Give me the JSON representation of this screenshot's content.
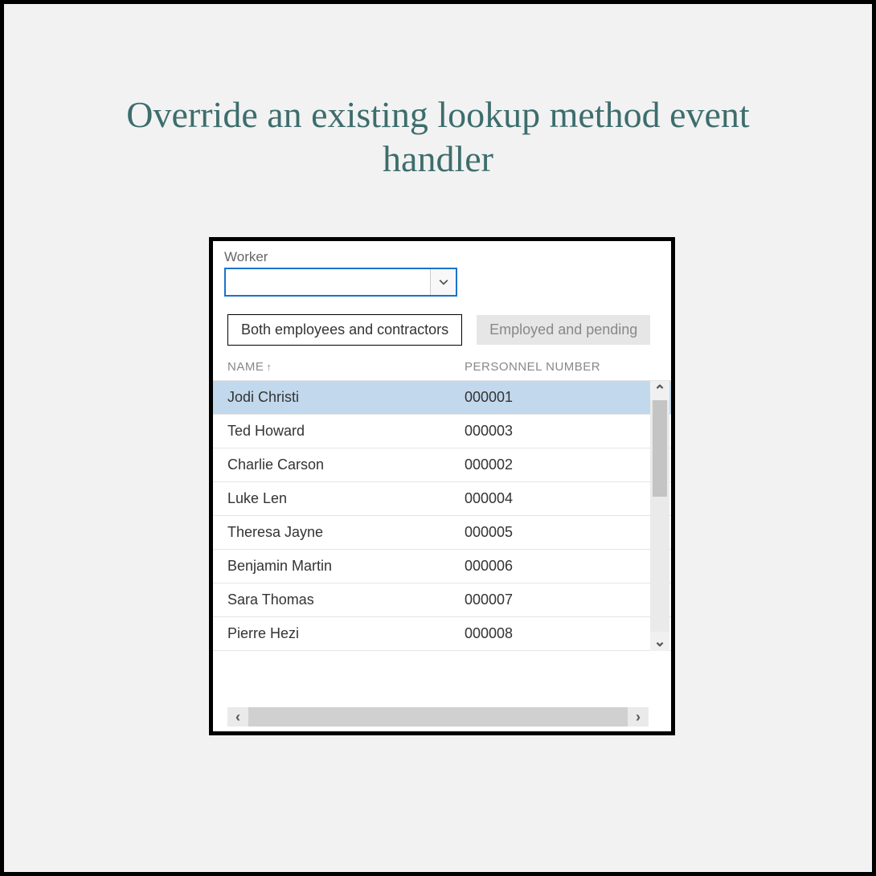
{
  "page": {
    "title": "Override an existing lookup method event handler"
  },
  "lookup": {
    "field_label": "Worker",
    "combo_value": "",
    "tabs": [
      {
        "label": "Both employees and contractors",
        "active": true
      },
      {
        "label": "Employed and pending",
        "active": false
      }
    ],
    "columns": {
      "name": "NAME",
      "personnel": "PERSONNEL NUMBER"
    },
    "sort_asc_glyph": "↑",
    "rows": [
      {
        "name": "Jodi Christi",
        "personnel": "000001",
        "selected": true,
        "marked": false
      },
      {
        "name": "Ted Howard",
        "personnel": "000003",
        "selected": false,
        "marked": false
      },
      {
        "name": "Charlie Carson",
        "personnel": "000002",
        "selected": false,
        "marked": false
      },
      {
        "name": "Luke Len",
        "personnel": "000004",
        "selected": false,
        "marked": false
      },
      {
        "name": "Theresa Jayne",
        "personnel": "000005",
        "selected": false,
        "marked": false
      },
      {
        "name": "Benjamin Martin",
        "personnel": "000006",
        "selected": false,
        "marked": false
      },
      {
        "name": "Sara Thomas",
        "personnel": "000007",
        "selected": false,
        "marked": true
      },
      {
        "name": "Pierre Hezi",
        "personnel": "000008",
        "selected": false,
        "marked": false
      }
    ]
  }
}
